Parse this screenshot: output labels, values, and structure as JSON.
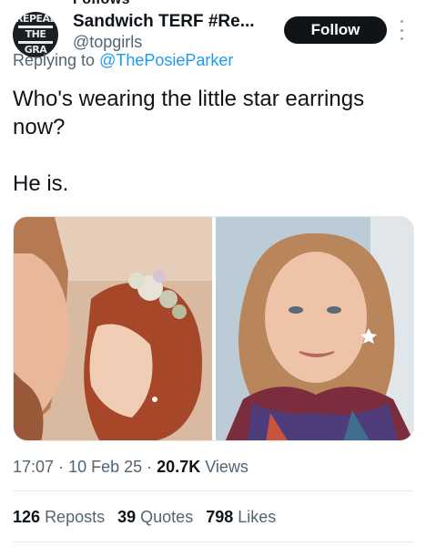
{
  "header_cut_text": "Follows",
  "author": {
    "avatar_text": [
      "REPEAL",
      "THE",
      "GRA"
    ],
    "display_name": "Sandwich TERF #Re...",
    "handle": "@topgirls"
  },
  "follow_button": "Follow",
  "reply": {
    "prefix": "Replying to",
    "target": "@ThePosieParker"
  },
  "tweet_text": "Who's wearing the little star earrings now?\n\nHe is.",
  "meta": {
    "time": "17:07",
    "sep1": "·",
    "date": "10 Feb 25",
    "sep2": "·",
    "views_count": "20.7K",
    "views_label": "Views"
  },
  "stats": {
    "reposts_count": "126",
    "reposts_label": "Reposts",
    "quotes_count": "39",
    "quotes_label": "Quotes",
    "likes_count": "798",
    "likes_label": "Likes"
  },
  "colors": {
    "text": "#0f1419",
    "secondary": "#536471",
    "link": "#1d9bf0",
    "button": "#0f1419"
  },
  "icons": [
    "more-vertical-icon"
  ]
}
